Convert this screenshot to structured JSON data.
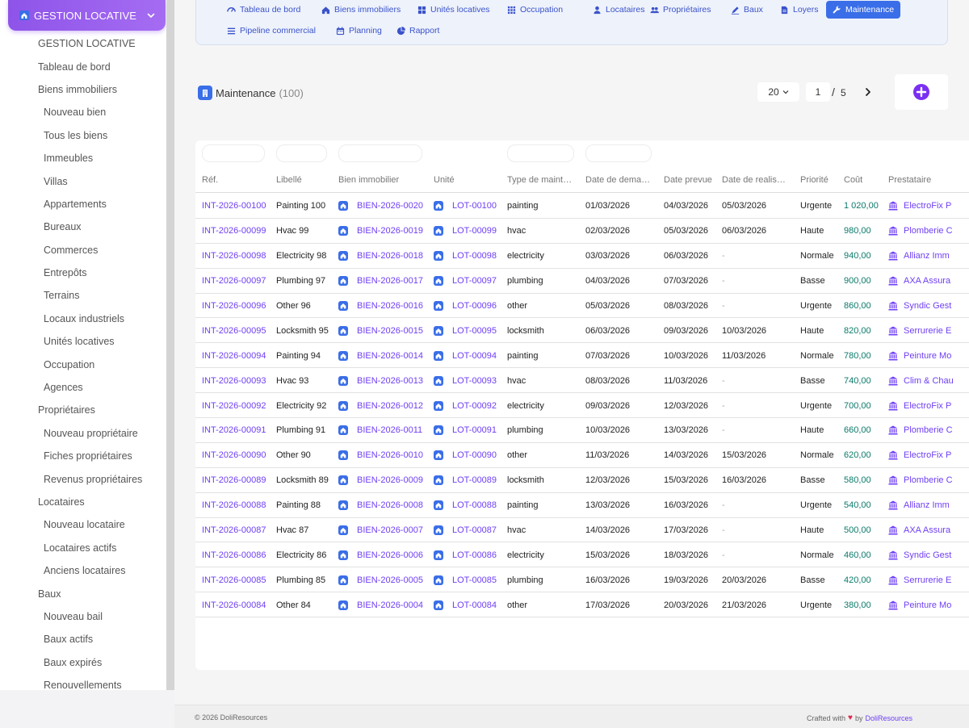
{
  "sidebar": {
    "menu_label": "GESTION LOCATIVE",
    "items": [
      {
        "label": "GESTION LOCATIVE",
        "level": 0
      },
      {
        "label": "Tableau de bord",
        "level": 0
      },
      {
        "label": "Biens immobiliers",
        "level": 0
      },
      {
        "label": "Nouveau bien",
        "level": 1
      },
      {
        "label": "Tous les biens",
        "level": 1
      },
      {
        "label": "Immeubles",
        "level": 1
      },
      {
        "label": "Villas",
        "level": 1
      },
      {
        "label": "Appartements",
        "level": 1
      },
      {
        "label": "Bureaux",
        "level": 1
      },
      {
        "label": "Commerces",
        "level": 1
      },
      {
        "label": "Entrepôts",
        "level": 1
      },
      {
        "label": "Terrains",
        "level": 1
      },
      {
        "label": "Locaux industriels",
        "level": 1
      },
      {
        "label": "Unités locatives",
        "level": 1
      },
      {
        "label": "Occupation",
        "level": 1
      },
      {
        "label": "Agences",
        "level": 1
      },
      {
        "label": "Propriétaires",
        "level": 0
      },
      {
        "label": "Nouveau propriétaire",
        "level": 1
      },
      {
        "label": "Fiches propriétaires",
        "level": 1
      },
      {
        "label": "Revenus propriétaires",
        "level": 1
      },
      {
        "label": "Locataires",
        "level": 0
      },
      {
        "label": "Nouveau locataire",
        "level": 1
      },
      {
        "label": "Locataires actifs",
        "level": 1
      },
      {
        "label": "Anciens locataires",
        "level": 1
      },
      {
        "label": "Baux",
        "level": 0
      },
      {
        "label": "Nouveau bail",
        "level": 1
      },
      {
        "label": "Baux actifs",
        "level": 1
      },
      {
        "label": "Baux expirés",
        "level": 1
      },
      {
        "label": "Renouvellements",
        "level": 1
      }
    ]
  },
  "tabs": [
    {
      "label": "Tableau de bord",
      "icon": "dashboard-icon"
    },
    {
      "label": "Biens immobiliers",
      "icon": "home-icon"
    },
    {
      "label": "Unités locatives",
      "icon": "grid-icon"
    },
    {
      "label": "Occupation",
      "icon": "grid-9-icon"
    },
    {
      "label": "Locataires",
      "icon": "user-icon"
    },
    {
      "label": "Propriétaires",
      "icon": "users-icon"
    },
    {
      "label": "Baux",
      "icon": "contract-icon"
    },
    {
      "label": "Loyers",
      "icon": "file-icon"
    },
    {
      "label": "Maintenance",
      "icon": "wrench-icon",
      "active": true
    },
    {
      "label": "Pipeline commercial",
      "icon": "list-icon"
    },
    {
      "label": "Planning",
      "icon": "calendar-icon"
    },
    {
      "label": "Rapport",
      "icon": "pie-chart-icon"
    }
  ],
  "page": {
    "title": "Maintenance",
    "count": "(100)",
    "per_page": "20",
    "current_page": "1",
    "separator": "/",
    "total_pages": "5"
  },
  "columns": [
    "Réf.",
    "Libellé",
    "Bien immobilier",
    "Unité",
    "Type de maint…",
    "Date de dema…",
    "Date prevue",
    "Date de realis…",
    "Priorité",
    "Coût",
    "Prestataire"
  ],
  "rows": [
    [
      "INT-2026-00100",
      "Painting 100",
      "BIEN-2026-0020",
      "LOT-00100",
      "painting",
      "01/03/2026",
      "04/03/2026",
      "05/03/2026",
      "Urgente",
      "1 020,00",
      "ElectroFix P"
    ],
    [
      "INT-2026-00099",
      "Hvac 99",
      "BIEN-2026-0019",
      "LOT-00099",
      "hvac",
      "02/03/2026",
      "05/03/2026",
      "06/03/2026",
      "Haute",
      "980,00",
      "Plomberie C"
    ],
    [
      "INT-2026-00098",
      "Electricity 98",
      "BIEN-2026-0018",
      "LOT-00098",
      "electricity",
      "03/03/2026",
      "06/03/2026",
      "-",
      "Normale",
      "940,00",
      "Allianz Imm"
    ],
    [
      "INT-2026-00097",
      "Plumbing 97",
      "BIEN-2026-0017",
      "LOT-00097",
      "plumbing",
      "04/03/2026",
      "07/03/2026",
      "-",
      "Basse",
      "900,00",
      "AXA Assura"
    ],
    [
      "INT-2026-00096",
      "Other 96",
      "BIEN-2026-0016",
      "LOT-00096",
      "other",
      "05/03/2026",
      "08/03/2026",
      "-",
      "Urgente",
      "860,00",
      "Syndic Gest"
    ],
    [
      "INT-2026-00095",
      "Locksmith 95",
      "BIEN-2026-0015",
      "LOT-00095",
      "locksmith",
      "06/03/2026",
      "09/03/2026",
      "10/03/2026",
      "Haute",
      "820,00",
      "Serrurerie E"
    ],
    [
      "INT-2026-00094",
      "Painting 94",
      "BIEN-2026-0014",
      "LOT-00094",
      "painting",
      "07/03/2026",
      "10/03/2026",
      "11/03/2026",
      "Normale",
      "780,00",
      "Peinture Mo"
    ],
    [
      "INT-2026-00093",
      "Hvac 93",
      "BIEN-2026-0013",
      "LOT-00093",
      "hvac",
      "08/03/2026",
      "11/03/2026",
      "-",
      "Basse",
      "740,00",
      "Clim & Chau"
    ],
    [
      "INT-2026-00092",
      "Electricity 92",
      "BIEN-2026-0012",
      "LOT-00092",
      "electricity",
      "09/03/2026",
      "12/03/2026",
      "-",
      "Urgente",
      "700,00",
      "ElectroFix P"
    ],
    [
      "INT-2026-00091",
      "Plumbing 91",
      "BIEN-2026-0011",
      "LOT-00091",
      "plumbing",
      "10/03/2026",
      "13/03/2026",
      "-",
      "Haute",
      "660,00",
      "Plomberie C"
    ],
    [
      "INT-2026-00090",
      "Other 90",
      "BIEN-2026-0010",
      "LOT-00090",
      "other",
      "11/03/2026",
      "14/03/2026",
      "15/03/2026",
      "Normale",
      "620,00",
      "ElectroFix P"
    ],
    [
      "INT-2026-00089",
      "Locksmith 89",
      "BIEN-2026-0009",
      "LOT-00089",
      "locksmith",
      "12/03/2026",
      "15/03/2026",
      "16/03/2026",
      "Basse",
      "580,00",
      "Plomberie C"
    ],
    [
      "INT-2026-00088",
      "Painting 88",
      "BIEN-2026-0008",
      "LOT-00088",
      "painting",
      "13/03/2026",
      "16/03/2026",
      "-",
      "Urgente",
      "540,00",
      "Allianz Imm"
    ],
    [
      "INT-2026-00087",
      "Hvac 87",
      "BIEN-2026-0007",
      "LOT-00087",
      "hvac",
      "14/03/2026",
      "17/03/2026",
      "-",
      "Haute",
      "500,00",
      "AXA Assura"
    ],
    [
      "INT-2026-00086",
      "Electricity 86",
      "BIEN-2026-0006",
      "LOT-00086",
      "electricity",
      "15/03/2026",
      "18/03/2026",
      "-",
      "Normale",
      "460,00",
      "Syndic Gest"
    ],
    [
      "INT-2026-00085",
      "Plumbing 85",
      "BIEN-2026-0005",
      "LOT-00085",
      "plumbing",
      "16/03/2026",
      "19/03/2026",
      "20/03/2026",
      "Basse",
      "420,00",
      "Serrurerie E"
    ],
    [
      "INT-2026-00084",
      "Other 84",
      "BIEN-2026-0004",
      "LOT-00084",
      "other",
      "17/03/2026",
      "20/03/2026",
      "21/03/2026",
      "Urgente",
      "380,00",
      "Peinture Mo"
    ]
  ],
  "footer": {
    "copyright": "© 2026 DoliResources",
    "crafted": "Crafted with",
    "by": "by",
    "brand": "DoliResources"
  },
  "colors": {
    "accent": "#6f3ff5",
    "primary_blue": "#3a6ee8",
    "money_green": "#0a7a6a",
    "menu_gradient_start": "#8e54e9",
    "heart": "#e0274a"
  }
}
